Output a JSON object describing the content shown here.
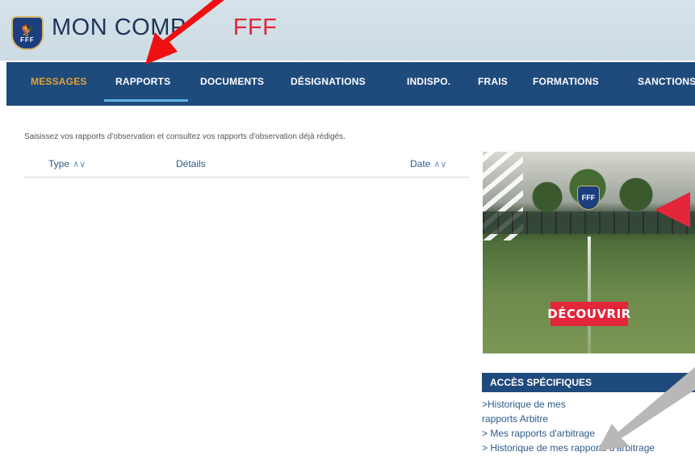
{
  "header": {
    "title_main": "MON COMP",
    "title_accent": "FFF",
    "logo_text": "FFF"
  },
  "nav": {
    "items": [
      "MESSAGES",
      "RAPPORTS",
      "DOCUMENTS",
      "DÉSIGNATIONS",
      "INDISPO.",
      "FRAIS",
      "FORMATIONS",
      "SANCTIONS"
    ],
    "active": "MESSAGES",
    "selected_underline": "RAPPORTS"
  },
  "main": {
    "intro": "Saisissez vos rapports d'observation et consultez vos rapports d'observation déjà rédigés.",
    "columns": {
      "type": "Type",
      "details": "Détails",
      "date": "Date"
    },
    "sort_icon": "∧∨"
  },
  "promo": {
    "button": "DÉCOUVRIR",
    "logo_text": "FFF"
  },
  "access": {
    "title": "ACCÈS SPÉCIFIQUES",
    "links": [
      ">Historique de mes",
      "rapports Arbitre",
      "> Mes rapports d'arbitrage",
      "> Historique de mes rapports d'arbitrage"
    ]
  },
  "colors": {
    "nav_bg": "#1f4a7c",
    "active_nav": "#e0a531",
    "accent_red": "#e3263a",
    "underline": "#5fb4e6"
  },
  "icons": {
    "logo": "fff-logo-icon",
    "sort": "sort-arrows-icon",
    "annotation_red": "red-pointer-arrow",
    "annotation_grey": "grey-pointer-arrow"
  }
}
